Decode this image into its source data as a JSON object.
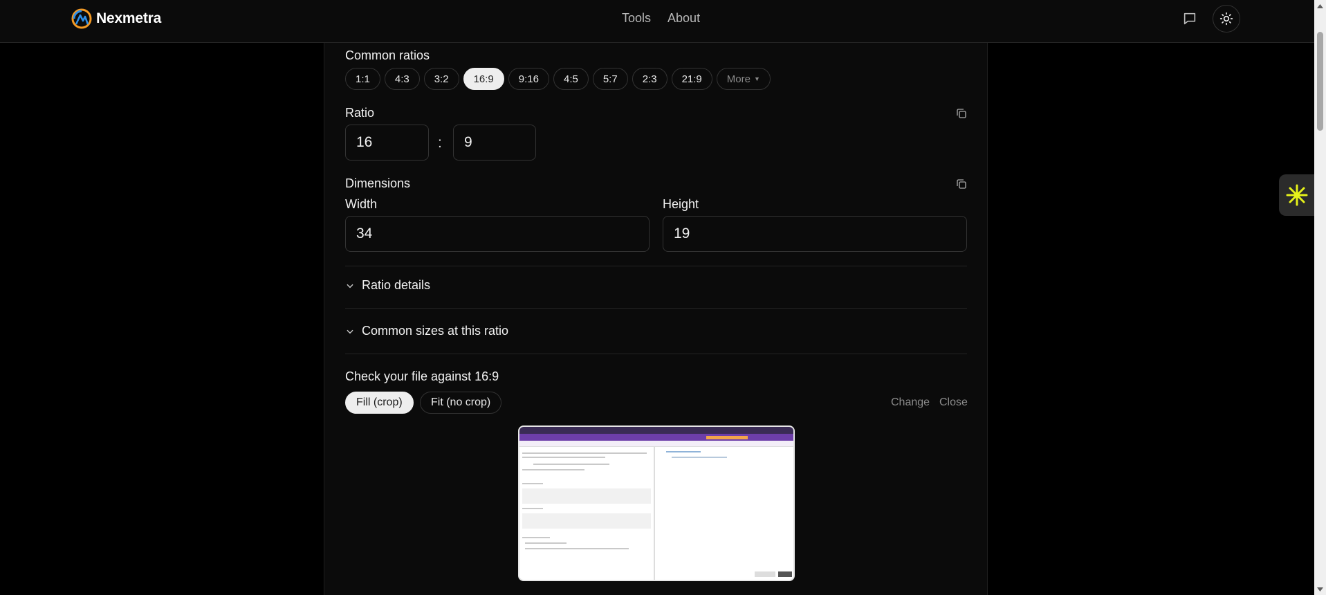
{
  "header": {
    "brand": "Nexmetra",
    "nav": [
      "Tools",
      "About"
    ],
    "feedback_icon": "chat-bubble-icon",
    "theme_icon": "sun-icon"
  },
  "ratios": {
    "label": "Common ratios",
    "chips": [
      "1:1",
      "4:3",
      "3:2",
      "16:9",
      "9:16",
      "4:5",
      "5:7",
      "2:3",
      "21:9"
    ],
    "active": "16:9",
    "more_label": "More"
  },
  "ratio": {
    "label": "Ratio",
    "left_value": "16",
    "separator": ":",
    "right_value": "9"
  },
  "dimensions": {
    "label": "Dimensions",
    "width_label": "Width",
    "width_value": "34",
    "height_label": "Height",
    "height_value": "19"
  },
  "accordions": [
    "Ratio details",
    "Common sizes at this ratio"
  ],
  "check": {
    "title": "Check your file against 16:9",
    "fill_label": "Fill (crop)",
    "fit_label": "Fit (no crop)",
    "change_label": "Change",
    "close_label": "Close"
  },
  "colors": {
    "background": "#000000",
    "panel": "#0b0b0b",
    "chip_active": "#eeeeee",
    "widget_accent": "#e6f21a"
  }
}
